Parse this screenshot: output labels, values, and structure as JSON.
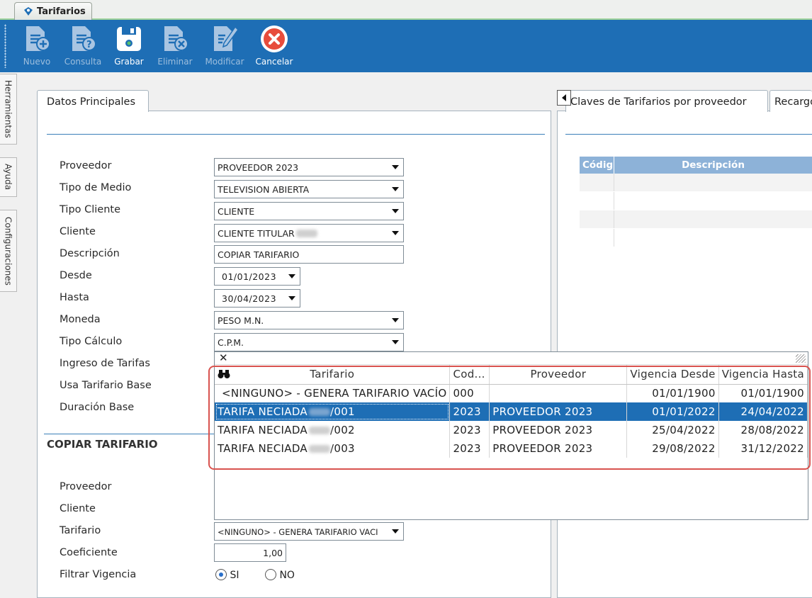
{
  "window_tab": {
    "title": "Tarifarios"
  },
  "toolbar": {
    "buttons": [
      {
        "label": "Nuevo",
        "icon": "doc-add-icon",
        "enabled": false
      },
      {
        "label": "Consulta",
        "icon": "doc-query-icon",
        "enabled": false
      },
      {
        "label": "Grabar",
        "icon": "save-icon",
        "enabled": true
      },
      {
        "label": "Eliminar",
        "icon": "doc-delete-icon",
        "enabled": false
      },
      {
        "label": "Modificar",
        "icon": "doc-edit-icon",
        "enabled": false
      },
      {
        "label": "Cancelar",
        "icon": "cancel-icon",
        "enabled": true
      }
    ]
  },
  "side_tabs": [
    "Herramientas",
    "Ayuda",
    "Configuraciones"
  ],
  "main_tab": {
    "label": "Datos Principales"
  },
  "right_tabs": [
    {
      "label": "Claves de Tarifarios por proveedor"
    },
    {
      "label": "Recargos"
    }
  ],
  "form": {
    "labels": {
      "proveedor": "Proveedor",
      "tipo_medio": "Tipo de Medio",
      "tipo_cliente": "Tipo Cliente",
      "cliente": "Cliente",
      "descripcion": "Descripción",
      "desde": "Desde",
      "hasta": "Hasta",
      "moneda": "Moneda",
      "tipo_calculo": "Tipo Cálculo",
      "ingreso_tarifas": "Ingreso de Tarifas",
      "usa_tarifario_base": "Usa Tarifario Base",
      "duracion_base": "Duración Base"
    },
    "values": {
      "proveedor": "PROVEEDOR 2023",
      "tipo_medio": "TELEVISION ABIERTA",
      "tipo_cliente": "CLIENTE",
      "cliente": "CLIENTE TITULAR",
      "descripcion": "COPIAR TARIFARIO",
      "desde": "01/01/2023",
      "hasta": "30/04/2023",
      "moneda": "PESO M.N.",
      "tipo_calculo": "C.P.M."
    }
  },
  "copiar": {
    "section_title": "COPIAR TARIFARIO",
    "labels": {
      "proveedor": "Proveedor",
      "cliente": "Cliente",
      "tarifario": "Tarifario",
      "coeficiente": "Coeficiente",
      "filtrar_vigencia": "Filtrar Vigencia"
    },
    "tarifario_value": "<NINGUNO> - GENERA TARIFARIO VACI",
    "coeficiente_value": "1,00",
    "radio_si": "SI",
    "radio_no": "NO",
    "filtrar_vigencia_selected": "SI"
  },
  "popup": {
    "close": "✕",
    "columns": [
      "Tarifario",
      "Cod...",
      "Proveedor",
      "Vigencia Desde",
      "Vigencia Hasta"
    ],
    "rows": [
      {
        "tarifario": "<NINGUNO> - GENERA TARIFARIO VACÍO",
        "suffix": "",
        "cod": "000",
        "proveedor": "",
        "desde": "01/01/1900",
        "hasta": "01/01/1900",
        "selected": false
      },
      {
        "tarifario": "TARIFA NECIADA",
        "suffix": "/001",
        "cod": "2023",
        "proveedor": "PROVEEDOR 2023",
        "desde": "01/01/2022",
        "hasta": "24/04/2022",
        "selected": true
      },
      {
        "tarifario": "TARIFA NECIADA",
        "suffix": "/002",
        "cod": "2023",
        "proveedor": "PROVEEDOR 2023",
        "desde": "25/04/2022",
        "hasta": "28/08/2022",
        "selected": false
      },
      {
        "tarifario": "TARIFA NECIADA",
        "suffix": "/003",
        "cod": "2023",
        "proveedor": "PROVEEDOR 2023",
        "desde": "29/08/2022",
        "hasta": "31/12/2022",
        "selected": false
      }
    ]
  },
  "right_grid": {
    "columns": [
      "Códig",
      "Descripción"
    ]
  },
  "colors": {
    "toolbar": "#1e6eb5",
    "selection": "#1e6eb5",
    "highlight": "#d9534f",
    "grid_header": "#8db2d8"
  }
}
